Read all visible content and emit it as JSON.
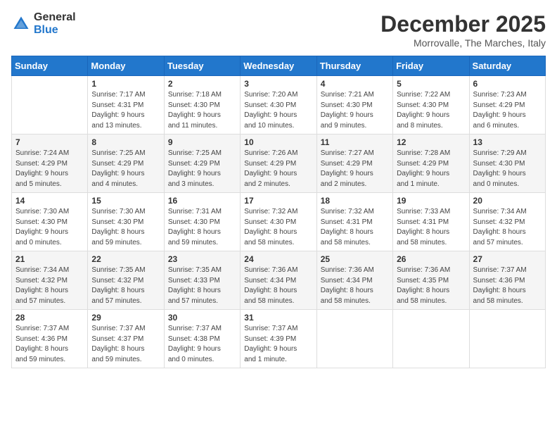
{
  "header": {
    "logo_general": "General",
    "logo_blue": "Blue",
    "month_title": "December 2025",
    "location": "Morrovalle, The Marches, Italy"
  },
  "days_of_week": [
    "Sunday",
    "Monday",
    "Tuesday",
    "Wednesday",
    "Thursday",
    "Friday",
    "Saturday"
  ],
  "weeks": [
    [
      {
        "day": "",
        "info": ""
      },
      {
        "day": "1",
        "info": "Sunrise: 7:17 AM\nSunset: 4:31 PM\nDaylight: 9 hours\nand 13 minutes."
      },
      {
        "day": "2",
        "info": "Sunrise: 7:18 AM\nSunset: 4:30 PM\nDaylight: 9 hours\nand 11 minutes."
      },
      {
        "day": "3",
        "info": "Sunrise: 7:20 AM\nSunset: 4:30 PM\nDaylight: 9 hours\nand 10 minutes."
      },
      {
        "day": "4",
        "info": "Sunrise: 7:21 AM\nSunset: 4:30 PM\nDaylight: 9 hours\nand 9 minutes."
      },
      {
        "day": "5",
        "info": "Sunrise: 7:22 AM\nSunset: 4:30 PM\nDaylight: 9 hours\nand 8 minutes."
      },
      {
        "day": "6",
        "info": "Sunrise: 7:23 AM\nSunset: 4:29 PM\nDaylight: 9 hours\nand 6 minutes."
      }
    ],
    [
      {
        "day": "7",
        "info": "Sunrise: 7:24 AM\nSunset: 4:29 PM\nDaylight: 9 hours\nand 5 minutes."
      },
      {
        "day": "8",
        "info": "Sunrise: 7:25 AM\nSunset: 4:29 PM\nDaylight: 9 hours\nand 4 minutes."
      },
      {
        "day": "9",
        "info": "Sunrise: 7:25 AM\nSunset: 4:29 PM\nDaylight: 9 hours\nand 3 minutes."
      },
      {
        "day": "10",
        "info": "Sunrise: 7:26 AM\nSunset: 4:29 PM\nDaylight: 9 hours\nand 2 minutes."
      },
      {
        "day": "11",
        "info": "Sunrise: 7:27 AM\nSunset: 4:29 PM\nDaylight: 9 hours\nand 2 minutes."
      },
      {
        "day": "12",
        "info": "Sunrise: 7:28 AM\nSunset: 4:29 PM\nDaylight: 9 hours\nand 1 minute."
      },
      {
        "day": "13",
        "info": "Sunrise: 7:29 AM\nSunset: 4:30 PM\nDaylight: 9 hours\nand 0 minutes."
      }
    ],
    [
      {
        "day": "14",
        "info": "Sunrise: 7:30 AM\nSunset: 4:30 PM\nDaylight: 9 hours\nand 0 minutes."
      },
      {
        "day": "15",
        "info": "Sunrise: 7:30 AM\nSunset: 4:30 PM\nDaylight: 8 hours\nand 59 minutes."
      },
      {
        "day": "16",
        "info": "Sunrise: 7:31 AM\nSunset: 4:30 PM\nDaylight: 8 hours\nand 59 minutes."
      },
      {
        "day": "17",
        "info": "Sunrise: 7:32 AM\nSunset: 4:30 PM\nDaylight: 8 hours\nand 58 minutes."
      },
      {
        "day": "18",
        "info": "Sunrise: 7:32 AM\nSunset: 4:31 PM\nDaylight: 8 hours\nand 58 minutes."
      },
      {
        "day": "19",
        "info": "Sunrise: 7:33 AM\nSunset: 4:31 PM\nDaylight: 8 hours\nand 58 minutes."
      },
      {
        "day": "20",
        "info": "Sunrise: 7:34 AM\nSunset: 4:32 PM\nDaylight: 8 hours\nand 57 minutes."
      }
    ],
    [
      {
        "day": "21",
        "info": "Sunrise: 7:34 AM\nSunset: 4:32 PM\nDaylight: 8 hours\nand 57 minutes."
      },
      {
        "day": "22",
        "info": "Sunrise: 7:35 AM\nSunset: 4:32 PM\nDaylight: 8 hours\nand 57 minutes."
      },
      {
        "day": "23",
        "info": "Sunrise: 7:35 AM\nSunset: 4:33 PM\nDaylight: 8 hours\nand 57 minutes."
      },
      {
        "day": "24",
        "info": "Sunrise: 7:36 AM\nSunset: 4:34 PM\nDaylight: 8 hours\nand 58 minutes."
      },
      {
        "day": "25",
        "info": "Sunrise: 7:36 AM\nSunset: 4:34 PM\nDaylight: 8 hours\nand 58 minutes."
      },
      {
        "day": "26",
        "info": "Sunrise: 7:36 AM\nSunset: 4:35 PM\nDaylight: 8 hours\nand 58 minutes."
      },
      {
        "day": "27",
        "info": "Sunrise: 7:37 AM\nSunset: 4:36 PM\nDaylight: 8 hours\nand 58 minutes."
      }
    ],
    [
      {
        "day": "28",
        "info": "Sunrise: 7:37 AM\nSunset: 4:36 PM\nDaylight: 8 hours\nand 59 minutes."
      },
      {
        "day": "29",
        "info": "Sunrise: 7:37 AM\nSunset: 4:37 PM\nDaylight: 8 hours\nand 59 minutes."
      },
      {
        "day": "30",
        "info": "Sunrise: 7:37 AM\nSunset: 4:38 PM\nDaylight: 9 hours\nand 0 minutes."
      },
      {
        "day": "31",
        "info": "Sunrise: 7:37 AM\nSunset: 4:39 PM\nDaylight: 9 hours\nand 1 minute."
      },
      {
        "day": "",
        "info": ""
      },
      {
        "day": "",
        "info": ""
      },
      {
        "day": "",
        "info": ""
      }
    ]
  ]
}
